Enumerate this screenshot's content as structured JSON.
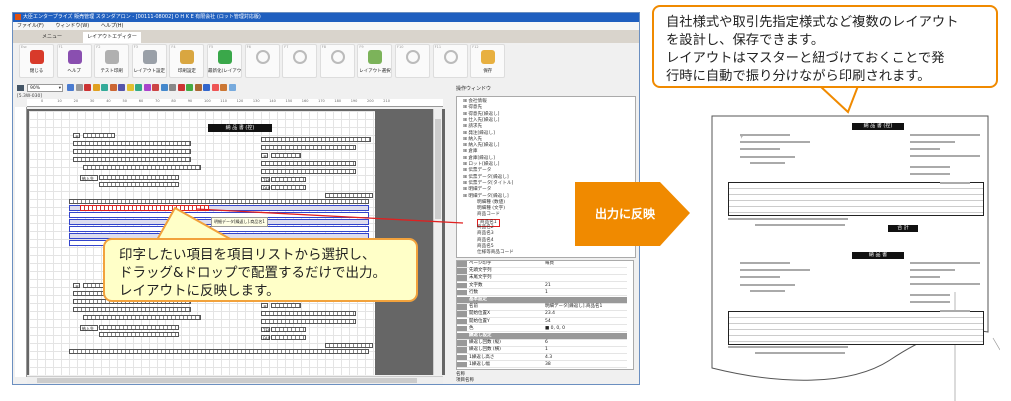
{
  "window": {
    "title": "大臣エンタープライズ 販売管理 スタンダアロン - [00111-08002] O H K E 有限会社 (ロット管理対応版)",
    "menu": [
      "ファイル(F)",
      "ウィンドウ(W)",
      "ヘルプ(H)"
    ],
    "tabs": [
      {
        "label": "メニュー",
        "active": false
      },
      {
        "label": "レイアウトエディター",
        "active": true
      }
    ]
  },
  "toolbar": [
    {
      "key": "Esc",
      "label": "閉じる",
      "icon": "close-window-icon",
      "color": "#d83a2a"
    },
    {
      "key": "F1",
      "label": "ヘルプ",
      "icon": "help-icon",
      "color": "#8a4fb0"
    },
    {
      "key": "F2",
      "label": "テスト印刷",
      "icon": "printer-icon",
      "color": "#b0b0b0"
    },
    {
      "key": "F3",
      "label": "レイアウト設定",
      "icon": "gear-icon",
      "color": "#9aa0a8"
    },
    {
      "key": "F4",
      "label": "印刷設定",
      "icon": "print-settings-icon",
      "color": "#d9a640"
    },
    {
      "key": "F5",
      "label": "最新化(レイアウト)",
      "icon": "refresh-icon",
      "color": "#3aa84a"
    },
    {
      "key": "F6",
      "label": "",
      "icon": "disabled-icon"
    },
    {
      "key": "F7",
      "label": "",
      "icon": "disabled-icon"
    },
    {
      "key": "F8",
      "label": "",
      "icon": "disabled-icon"
    },
    {
      "key": "F9",
      "label": "レイアウト選択",
      "icon": "layout-select-icon",
      "color": "#7cb35a"
    },
    {
      "key": "F10",
      "label": "",
      "icon": "disabled-icon"
    },
    {
      "key": "F11",
      "label": "",
      "icon": "disabled-icon"
    },
    {
      "key": "F12",
      "label": "保存",
      "icon": "save-folder-icon",
      "color": "#e8b040"
    }
  ],
  "editor": {
    "zoom": "90%",
    "coord": "[5.3W-030]",
    "ruler_ticks": [
      "0",
      "10",
      "20",
      "30",
      "40",
      "50",
      "60",
      "70",
      "80",
      "90",
      "100",
      "110",
      "120",
      "130",
      "140",
      "150",
      "160",
      "170",
      "180",
      "190",
      "200",
      "210"
    ],
    "doc_title": "納 品 書 (控)",
    "postal_mark": "〒",
    "delivery_label": "納入先",
    "tel_label": "TEL",
    "fax_label": "FAX",
    "tooltip": "明細データ[繰返し].商品名1"
  },
  "panel": {
    "title": "操作ウィンドウ",
    "tree": [
      {
        "label": "会社情報"
      },
      {
        "label": "得意先"
      },
      {
        "label": "得意先[繰返し]"
      },
      {
        "label": "仕入先[繰返し]"
      },
      {
        "label": "請求先"
      },
      {
        "label": "発注[繰返し]"
      },
      {
        "label": "納入先"
      },
      {
        "label": "納入先[繰返し]"
      },
      {
        "label": "倉庫"
      },
      {
        "label": "倉庫[繰返し]"
      },
      {
        "label": "ロット[繰返し]"
      },
      {
        "label": "伝票データ"
      },
      {
        "label": "伝票データ[繰返し]"
      },
      {
        "label": "伝票データ[タイトル]"
      },
      {
        "label": "明細データ"
      },
      {
        "label": "明細データ[繰返し]"
      },
      {
        "label": "明細種 (数値)",
        "child": true
      },
      {
        "label": "明細種 (文字)",
        "child": true
      },
      {
        "label": "商品コード",
        "child": true
      },
      {
        "label": "商品名1",
        "child": true,
        "selected": true
      },
      {
        "label": "商品名2",
        "child": true
      },
      {
        "label": "商品名3",
        "child": true
      },
      {
        "label": "商品名4",
        "child": true
      },
      {
        "label": "商品名5",
        "child": true
      },
      {
        "label": "仕様等商品コード",
        "child": true
      }
    ],
    "properties": [
      {
        "key": "ページ印字",
        "value": "毎頁"
      },
      {
        "key": "先頭文字列",
        "value": ""
      },
      {
        "key": "末尾文字列",
        "value": ""
      },
      {
        "key": "文字数",
        "value": "21"
      },
      {
        "key": "行数",
        "value": "1"
      },
      {
        "section": "基本設定"
      },
      {
        "key": "名前",
        "value": "明細データ[繰返し].商品名1"
      },
      {
        "key": "開始位置X",
        "value": "23.4"
      },
      {
        "key": "開始位置Y",
        "value": "54"
      },
      {
        "key": "色",
        "value": "■ 0, 0, 0"
      },
      {
        "section": "繰返し設定"
      },
      {
        "key": "繰返し回数 (縦)",
        "value": "6"
      },
      {
        "key": "繰返し回数 (横)",
        "value": "1"
      },
      {
        "key": "1繰返し高さ",
        "value": "4.3"
      },
      {
        "key": "1繰返し幅",
        "value": "38"
      }
    ],
    "footer_name": "名称",
    "footer_desc": "項目名称"
  },
  "bubble": {
    "lines": [
      "印字したい項目を項目リストから選択し、",
      "ドラッグ&ドロップで配置するだけで出力。",
      "レイアウトに反映します。"
    ]
  },
  "arrow": {
    "label": "出力に反映",
    "color": "#f08a00"
  },
  "callout": {
    "lines": [
      "自社様式や取引先指定様式など複数のレイアウト",
      "を設計し、保存できます。",
      "レイアウトはマスターと紐づけておくことで発",
      "行時に自動で振り分けながら印刷されます。"
    ]
  },
  "paper": {
    "title_copy": "納 品 書 (控)",
    "title": "納 品 書",
    "total_label": "合 計"
  }
}
